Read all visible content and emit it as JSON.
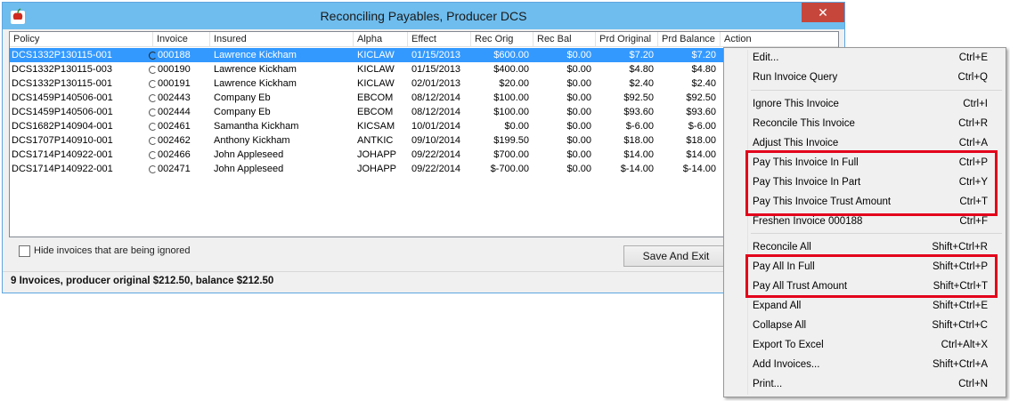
{
  "window": {
    "title": "Reconciling Payables, Producer DCS",
    "close_glyph": "✕",
    "app_icon": "apple-logo-icon"
  },
  "table": {
    "columns": [
      "Policy",
      "Invoice",
      "Insured",
      "Alpha",
      "Effect",
      "Rec Orig",
      "Rec Bal",
      "Prd Original",
      "Prd Balance",
      "Action"
    ],
    "rows": [
      {
        "policy": "DCS1332P130115-001",
        "invoice": "000188",
        "insured": "Lawrence Kickham",
        "alpha": "KICLAW",
        "effect": "01/15/2013",
        "rec_orig": "$600.00",
        "rec_bal": "$0.00",
        "prd_original": "$7.20",
        "prd_balance": "$7.20",
        "selected": true
      },
      {
        "policy": "DCS1332P130115-003",
        "invoice": "000190",
        "insured": "Lawrence Kickham",
        "alpha": "KICLAW",
        "effect": "01/15/2013",
        "rec_orig": "$400.00",
        "rec_bal": "$0.00",
        "prd_original": "$4.80",
        "prd_balance": "$4.80",
        "selected": false
      },
      {
        "policy": "DCS1332P130115-001",
        "invoice": "000191",
        "insured": "Lawrence Kickham",
        "alpha": "KICLAW",
        "effect": "02/01/2013",
        "rec_orig": "$20.00",
        "rec_bal": "$0.00",
        "prd_original": "$2.40",
        "prd_balance": "$2.40",
        "selected": false
      },
      {
        "policy": "DCS1459P140506-001",
        "invoice": "002443",
        "insured": "Company Eb",
        "alpha": "EBCOM",
        "effect": "08/12/2014",
        "rec_orig": "$100.00",
        "rec_bal": "$0.00",
        "prd_original": "$92.50",
        "prd_balance": "$92.50",
        "selected": false
      },
      {
        "policy": "DCS1459P140506-001",
        "invoice": "002444",
        "insured": "Company Eb",
        "alpha": "EBCOM",
        "effect": "08/12/2014",
        "rec_orig": "$100.00",
        "rec_bal": "$0.00",
        "prd_original": "$93.60",
        "prd_balance": "$93.60",
        "selected": false
      },
      {
        "policy": "DCS1682P140904-001",
        "invoice": "002461",
        "insured": "Samantha Kickham",
        "alpha": "KICSAM",
        "effect": "10/01/2014",
        "rec_orig": "$0.00",
        "rec_bal": "$0.00",
        "prd_original": "$-6.00",
        "prd_balance": "$-6.00",
        "selected": false
      },
      {
        "policy": "DCS1707P140910-001",
        "invoice": "002462",
        "insured": "Anthony Kickham",
        "alpha": "ANTKIC",
        "effect": "09/10/2014",
        "rec_orig": "$199.50",
        "rec_bal": "$0.00",
        "prd_original": "$18.00",
        "prd_balance": "$18.00",
        "selected": false
      },
      {
        "policy": "DCS1714P140922-001",
        "invoice": "002466",
        "insured": "John Appleseed",
        "alpha": "JOHAPP",
        "effect": "09/22/2014",
        "rec_orig": "$700.00",
        "rec_bal": "$0.00",
        "prd_original": "$14.00",
        "prd_balance": "$14.00",
        "selected": false
      },
      {
        "policy": "DCS1714P140922-001",
        "invoice": "002471",
        "insured": "John Appleseed",
        "alpha": "JOHAPP",
        "effect": "09/22/2014",
        "rec_orig": "$-700.00",
        "rec_bal": "$0.00",
        "prd_original": "$-14.00",
        "prd_balance": "$-14.00",
        "selected": false
      }
    ]
  },
  "options": {
    "hide_ignored_label": "Hide invoices that are being ignored",
    "hide_ignored_checked": false
  },
  "buttons": {
    "save_and_exit": "Save And Exit"
  },
  "status": {
    "text": "9 Invoices, producer original $212.50, balance $212.50"
  },
  "context_menu": {
    "items": [
      {
        "label": "Edit...",
        "shortcut": "Ctrl+E"
      },
      {
        "label": "Run Invoice Query",
        "shortcut": "Ctrl+Q"
      },
      {
        "label": "Ignore This Invoice",
        "shortcut": "Ctrl+I"
      },
      {
        "label": "Reconcile This Invoice",
        "shortcut": "Ctrl+R"
      },
      {
        "label": "Adjust This Invoice",
        "shortcut": "Ctrl+A"
      },
      {
        "label": "Pay This Invoice In Full",
        "shortcut": "Ctrl+P"
      },
      {
        "label": "Pay This Invoice In Part",
        "shortcut": "Ctrl+Y"
      },
      {
        "label": "Pay This Invoice Trust Amount",
        "shortcut": "Ctrl+T"
      },
      {
        "label": "Freshen Invoice 000188",
        "shortcut": "Ctrl+F"
      },
      {
        "label": "Reconcile All",
        "shortcut": "Shift+Ctrl+R"
      },
      {
        "label": "Pay All In Full",
        "shortcut": "Shift+Ctrl+P"
      },
      {
        "label": "Pay All Trust Amount",
        "shortcut": "Shift+Ctrl+T"
      },
      {
        "label": "Expand All",
        "shortcut": "Shift+Ctrl+E"
      },
      {
        "label": "Collapse All",
        "shortcut": "Shift+Ctrl+C"
      },
      {
        "label": "Export To Excel",
        "shortcut": "Ctrl+Alt+X"
      },
      {
        "label": "Add Invoices...",
        "shortcut": "Shift+Ctrl+A"
      },
      {
        "label": "Print...",
        "shortcut": "Ctrl+N"
      }
    ],
    "highlight_color": "#e3001b"
  }
}
